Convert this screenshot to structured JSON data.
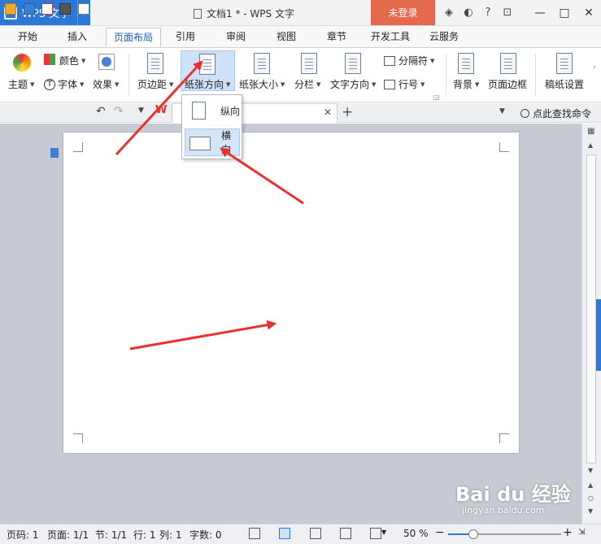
{
  "titlebar": {
    "app_name": "WPS 文字",
    "doc_title": "文档1 * - WPS 文字",
    "login_label": "未登录",
    "icons": [
      "skin-icon",
      "feedback-icon",
      "help-icon",
      "restore-app-icon"
    ],
    "window": [
      "minimize-icon",
      "maximize-icon",
      "close-icon"
    ]
  },
  "tabs": [
    {
      "label": "开始"
    },
    {
      "label": "插入"
    },
    {
      "label": "页面布局",
      "active": true
    },
    {
      "label": "引用"
    },
    {
      "label": "审阅"
    },
    {
      "label": "视图"
    },
    {
      "label": "章节"
    },
    {
      "label": "开发工具"
    },
    {
      "label": "云服务"
    }
  ],
  "ribbon": {
    "theme": "主题",
    "color": "颜色",
    "font": "字体",
    "effect": "效果",
    "margins": "页边距",
    "orientation": "纸张方向",
    "size": "纸张大小",
    "columns": "分栏",
    "text_direction": "文字方向",
    "breaks": "分隔符",
    "line_numbers": "行号",
    "background": "背景",
    "page_border": "页面边框",
    "manuscript": "稿纸设置"
  },
  "quickbar": {
    "search_label": "点此查找命令"
  },
  "orientation_menu": {
    "portrait": "纵向",
    "landscape": "横向",
    "selected": "landscape"
  },
  "status": {
    "page_no": "页码: 1",
    "page": "页面: 1/1",
    "section": "节: 1/1",
    "line": "行: 1",
    "column": "列: 1",
    "words": "字数: 0",
    "zoom": "50 %",
    "zoom_percent": 50
  },
  "watermark": {
    "main": "Bai du 经验",
    "sub": "jingyan.baidu.com"
  },
  "colors": {
    "accent": "#2b78d6",
    "login": "#e56a4d",
    "arrow": "#e8322e",
    "workspace": "#c6cbd3"
  }
}
